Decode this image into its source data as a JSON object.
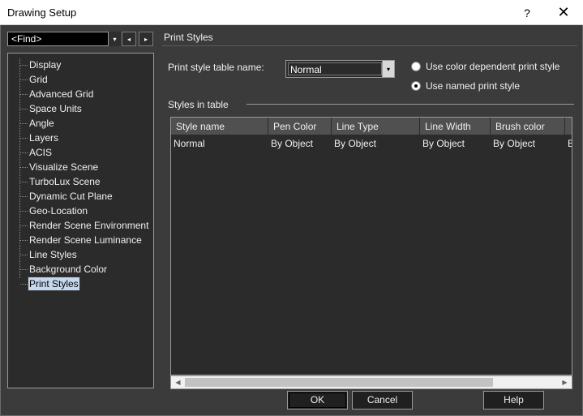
{
  "window": {
    "title": "Drawing Setup",
    "help_glyph": "?",
    "close_glyph": "✕"
  },
  "find": {
    "value": "<Find>",
    "dropdown_glyph": "▾",
    "back_glyph": "◂",
    "forward_glyph": "▸"
  },
  "tree": {
    "items": [
      {
        "label": "Display"
      },
      {
        "label": "Grid"
      },
      {
        "label": "Advanced Grid"
      },
      {
        "label": "Space Units"
      },
      {
        "label": "Angle"
      },
      {
        "label": "Layers"
      },
      {
        "label": "ACIS"
      },
      {
        "label": "Visualize Scene"
      },
      {
        "label": "TurboLux Scene"
      },
      {
        "label": "Dynamic Cut Plane"
      },
      {
        "label": "Geo-Location"
      },
      {
        "label": "Render Scene Environment"
      },
      {
        "label": "Render Scene Luminance"
      },
      {
        "label": "Line Styles"
      },
      {
        "label": "Background Color"
      },
      {
        "label": "Print Styles"
      }
    ],
    "selected": "Print Styles"
  },
  "panel": {
    "title": "Print Styles",
    "style_table_label": "Print style table name:",
    "style_table_value": "Normal",
    "combo_glyph": "▾",
    "radio_color_dependent": "Use color dependent  print style",
    "radio_named": "Use named print style",
    "styles_in_table_label": "Styles in table"
  },
  "table": {
    "columns": [
      "Style name",
      "Pen Color",
      "Line Type",
      "Line Width",
      "Brush color",
      ""
    ],
    "rows": [
      [
        "Normal",
        "By Object",
        "By Object",
        "By Object",
        "By Object",
        "B"
      ]
    ]
  },
  "scrollbar": {
    "left_glyph": "◀",
    "right_glyph": "▶"
  },
  "buttons": {
    "ok": "OK",
    "cancel": "Cancel",
    "help": "Help"
  }
}
